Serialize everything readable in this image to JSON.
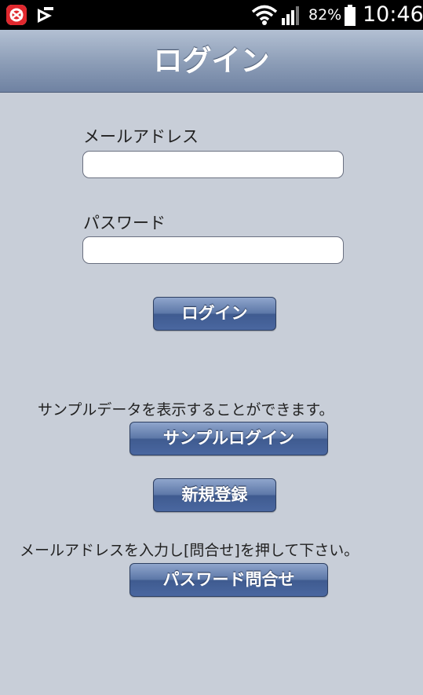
{
  "status_bar": {
    "battery_percent": "82%",
    "time": "10:46",
    "icons": [
      "app-icon",
      "app-icon",
      "wifi-icon",
      "signal-icon",
      "battery-icon"
    ]
  },
  "header": {
    "title": "ログイン"
  },
  "form": {
    "email_label": "メールアドレス",
    "email_value": "",
    "password_label": "パスワード",
    "password_value": "",
    "login_button": "ログイン"
  },
  "sample": {
    "description": "サンプルデータを表示することができます。",
    "button": "サンプルログイン"
  },
  "register": {
    "button": "新規登録"
  },
  "password_inquiry": {
    "description": "メールアドレスを入力し[問合せ]を押して下さい。",
    "button": "パスワード問合せ"
  },
  "colors": {
    "background": "#c8ced8",
    "header_top": "#b3c0d3",
    "header_bottom": "#6f82a2",
    "button_top": "#8fa5cc",
    "button_bottom": "#4a67a0"
  }
}
